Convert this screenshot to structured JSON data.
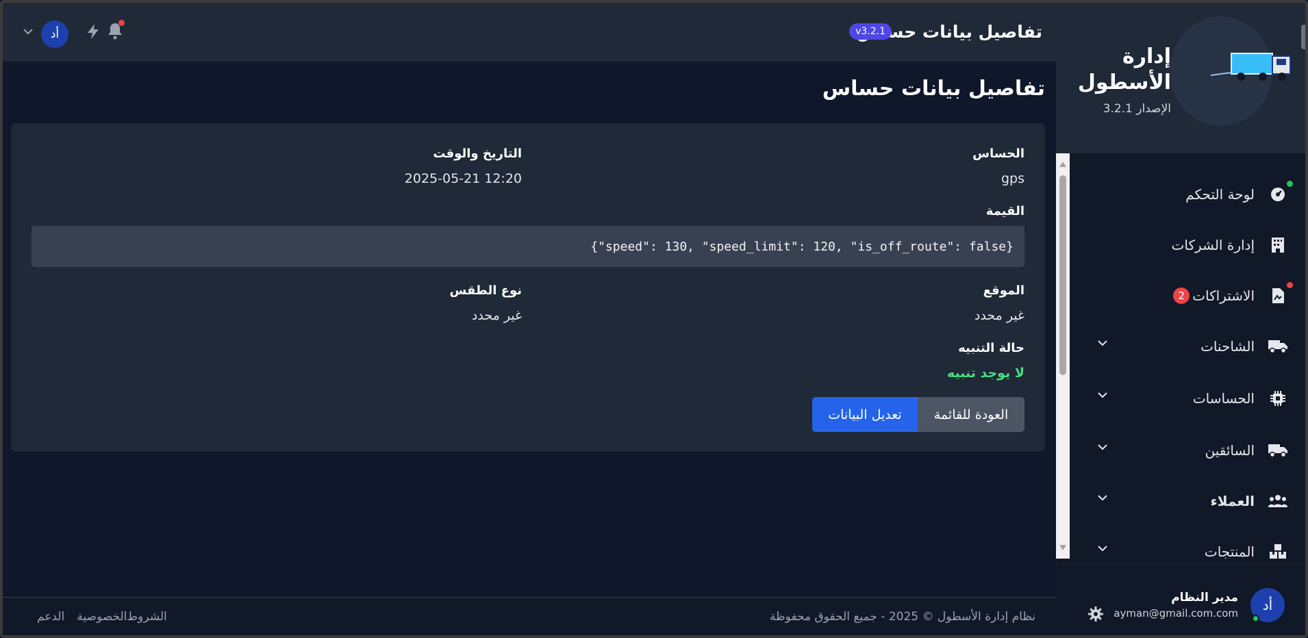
{
  "brand": {
    "title": "إدارة الأسطول",
    "version": "الإصدار 3.2.1"
  },
  "sidebar": {
    "items": [
      {
        "label": "لوحة التحكم",
        "icon": "gauge-icon"
      },
      {
        "label": "إدارة الشركات",
        "icon": "building-icon"
      },
      {
        "label": "الاشتراكات",
        "icon": "document-icon",
        "badge": "2"
      },
      {
        "label": "الشاحنات",
        "icon": "truck-icon"
      },
      {
        "label": "الحساسات",
        "icon": "chip-icon"
      },
      {
        "label": "السائقين",
        "icon": "truck-icon"
      },
      {
        "label": "العملاء",
        "icon": "users-icon"
      },
      {
        "label": "المنتجات",
        "icon": "boxes-icon"
      }
    ]
  },
  "user": {
    "name": "مدير النظام",
    "email": "ayman@gmail.com.com",
    "initials": "أد"
  },
  "topbar": {
    "title": "تفاصيل بيانات حساس",
    "version_badge": "v3.2.1",
    "avatar_initials": "أد"
  },
  "page": {
    "title": "تفاصيل بيانات حساس"
  },
  "details": {
    "sensor_label": "الحساس",
    "sensor_value": "gps",
    "datetime_label": "التاريخ والوقت",
    "datetime_value": "2025-05-21 12:20",
    "value_label": "القيمة",
    "value_json": "{\"speed\": 130, \"speed_limit\": 120, \"is_off_route\": false}",
    "location_label": "الموقع",
    "location_value": "غير محدد",
    "weather_label": "نوع الطقس",
    "weather_value": "غير محدد",
    "alert_label": "حالة التنبيه",
    "alert_value": "لا يوجد تنبيه"
  },
  "buttons": {
    "back": "العودة للقائمة",
    "edit": "تعديل البيانات"
  },
  "footer": {
    "copyright": "نظام إدارة الأسطول © 2025 - جميع الحقوق محفوظة",
    "links": [
      "الشروط",
      "الخصوصية",
      "الدعم"
    ]
  },
  "colors": {
    "background": "#0f172a",
    "panel": "#1f2937",
    "accent": "#2563eb",
    "badge": "#4f46e5",
    "success": "#4ade80",
    "danger": "#ef4444"
  }
}
